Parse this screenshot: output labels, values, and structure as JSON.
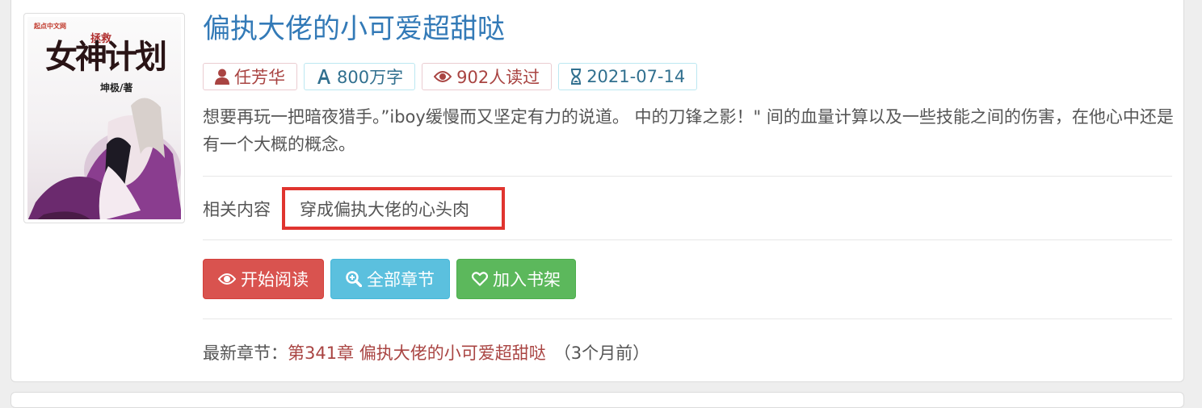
{
  "book": {
    "title": "偏执大佬的小可爱超甜哒",
    "cover": {
      "logo_text": "起点中文网",
      "sub_title": "拯救",
      "main_title": "女神计划",
      "author_text": "坤极/著"
    },
    "tags": {
      "author": "任芳华",
      "word_count": "800万字",
      "readers": "902人读过",
      "date": "2021-07-14"
    },
    "description": "想要再玩一把暗夜猎手。”iboy缓慢而又坚定有力的说道。 中的刀锋之影！\" 间的血量计算以及一些技能之间的伤害，在他心中还是有一个大概的概念。",
    "related": {
      "label": "相关内容",
      "link": "穿成偏执大佬的心头肉"
    },
    "buttons": {
      "read": "开始阅读",
      "chapters": "全部章节",
      "shelf": "加入书架"
    },
    "latest": {
      "label": "最新章节：",
      "chapter": "第341章 偏执大佬的小可爱超甜哒",
      "time": "（3个月前）"
    }
  },
  "colors": {
    "link_blue": "#337ab7",
    "danger": "#d9534f",
    "info": "#5bc0de",
    "success": "#5cb85c",
    "highlight_box": "#e0342f"
  },
  "icons": {
    "author": "user-icon",
    "word_count": "font-icon",
    "readers": "eye-icon",
    "date": "hourglass-icon",
    "read": "eye-icon",
    "chapters": "zoom-in-icon",
    "shelf": "heart-icon"
  }
}
